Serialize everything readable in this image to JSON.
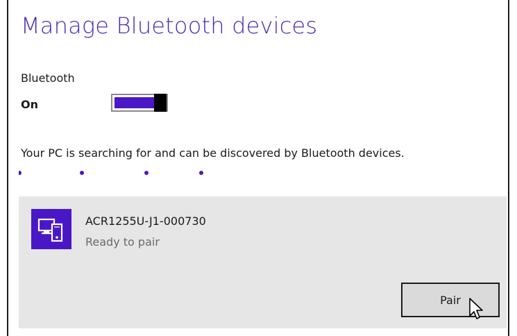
{
  "page": {
    "title": "Manage Bluetooth devices"
  },
  "bluetooth": {
    "section_label": "Bluetooth",
    "state_label": "On",
    "enabled": true,
    "status_text": "Your PC is searching for and can be discovered by Bluetooth devices."
  },
  "device": {
    "name": "ACR1255U-J1-000730",
    "status": "Ready to pair",
    "icon": "devices-icon",
    "pair_label": "Pair"
  },
  "colors": {
    "accent": "#4a17c7",
    "title": "#4b2bb3",
    "card_background": "#e6e6e6"
  }
}
